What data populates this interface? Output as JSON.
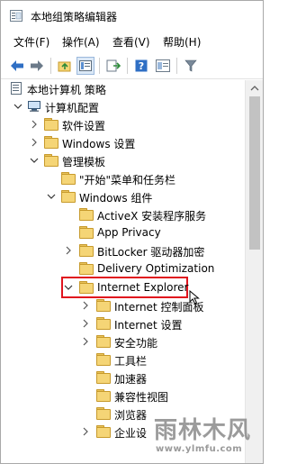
{
  "window": {
    "title": "本地组策略编辑器"
  },
  "menu": {
    "items": [
      "文件(F)",
      "操作(A)",
      "查看(V)",
      "帮助(H)"
    ]
  },
  "toolbar": {
    "buttons": [
      "back-arrow",
      "forward-arrow",
      "up-folder",
      "show-hide-tree",
      "export-list",
      "help",
      "properties",
      "filter"
    ]
  },
  "tree": {
    "root": "本地计算机 策略",
    "computer_config": "计算机配置",
    "software_settings": "软件设置",
    "windows_settings": "Windows 设置",
    "admin_templates": "管理模板",
    "start_menu_taskbar": "\"开始\"菜单和任务栏",
    "windows_components": "Windows 组件",
    "activex": "ActiveX 安装程序服务",
    "app_privacy": "App Privacy",
    "bitlocker": "BitLocker 驱动器加密",
    "delivery_opt": "Delivery Optimization",
    "internet_explorer": "Internet Explorer",
    "ie_control_panel": "Internet 控制面板",
    "ie_settings": "Internet 设置",
    "security_features": "安全功能",
    "toolbars": "工具栏",
    "accelerators": "加速器",
    "compat_view": "兼容性视图",
    "browser": "浏览器",
    "enterprise": "企业设"
  },
  "colors": {
    "highlight": "#e0141e",
    "folder": "#f5d576"
  },
  "watermark": {
    "text": "雨林木风",
    "url": "www.ylmfu.com"
  }
}
